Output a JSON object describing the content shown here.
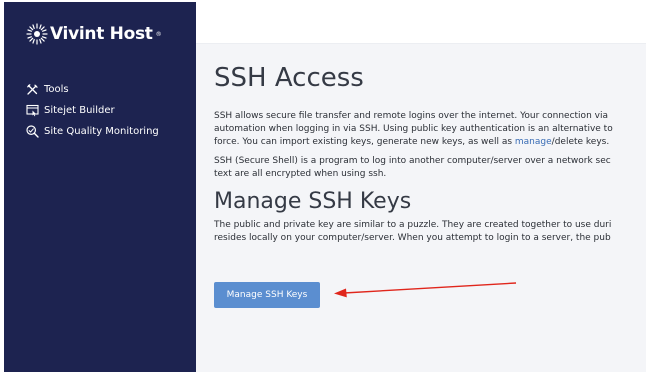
{
  "brand": {
    "name": "Vivint Host",
    "registered_mark": "®"
  },
  "sidebar": {
    "items": [
      {
        "label": "Tools",
        "icon": "tools-icon"
      },
      {
        "label": "Sitejet Builder",
        "icon": "sitejet-builder-icon"
      },
      {
        "label": "Site Quality Monitoring",
        "icon": "site-quality-icon"
      }
    ]
  },
  "main": {
    "title": "SSH Access",
    "intro": [
      "SSH allows secure file transfer and remote logins over the internet. Your connection via",
      "automation when logging in via SSH. Using public key authentication is an alternative to",
      "force. You can import existing keys, generate new keys, as well as "
    ],
    "intro_link": "manage",
    "intro_tail": "/delete keys.",
    "ssh_description": [
      "SSH (Secure Shell) is a program to log into another computer/server over a network sec",
      "text are all encrypted when using ssh."
    ],
    "section_title": "Manage SSH Keys",
    "section_text": [
      "The public and private key are similar to a puzzle. They are created together to use duri",
      "resides locally on your computer/server. When you attempt to login to a server, the pub"
    ],
    "button_label": "Manage SSH Keys"
  },
  "colors": {
    "sidebar_bg": "#1d2350",
    "button_bg": "#5b8ed0",
    "link": "#3a6db5",
    "annotation_arrow": "#e0261c"
  }
}
